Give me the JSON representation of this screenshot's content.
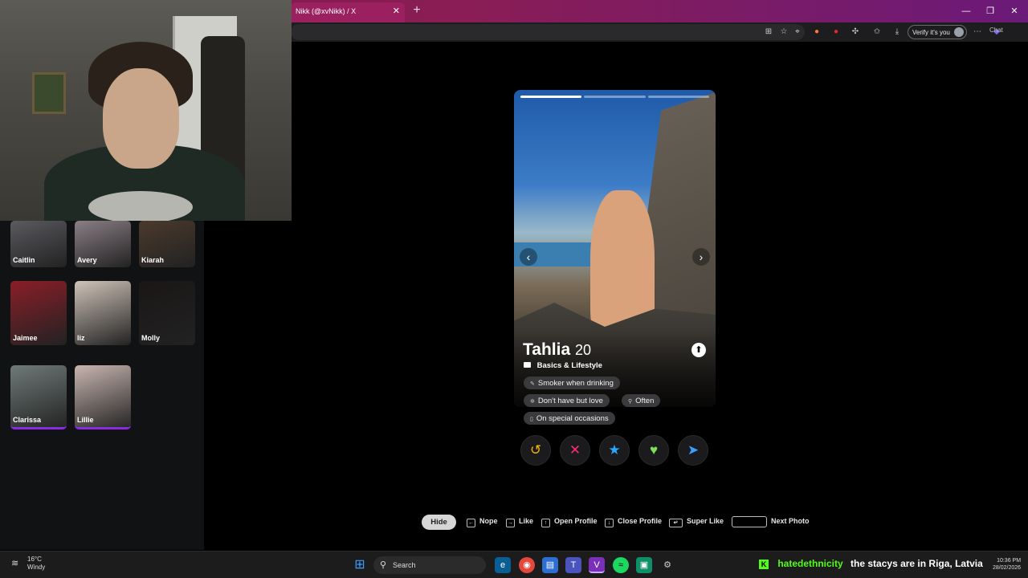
{
  "browser": {
    "tab_title": "Nikk (@xvNikk) / X",
    "tab_close": "✕",
    "new_tab": "+",
    "verify_label": "Verify it's you",
    "chat_label": "Chat",
    "window_controls": {
      "minimize": "—",
      "restore": "❐",
      "close": "✕"
    }
  },
  "matches": [
    {
      "name": "Caitlin",
      "color": "#5a5a60"
    },
    {
      "name": "Avery",
      "color": "#8a7f86"
    },
    {
      "name": "Kiarah",
      "color": "#4b3a2c"
    },
    {
      "name": "Jaimee",
      "color": "#8a1e28"
    },
    {
      "name": "liz",
      "color": "#cfc3b8"
    },
    {
      "name": "Molly",
      "color": "#1a1616"
    },
    {
      "name": "Clarissa",
      "color": "#6f7a78"
    },
    {
      "name": "Lillie",
      "color": "#c9b6b0"
    }
  ],
  "profile": {
    "name": "Tahlia",
    "age": "20",
    "section_title": "Basics & Lifestyle",
    "tags": [
      "Smoker when drinking",
      "Don't have but love",
      "Often",
      "On special occasions"
    ],
    "photo_index": 1,
    "photo_count": 3
  },
  "actions": {
    "rewind": "↺",
    "nope": "✕",
    "super_like": "★",
    "like": "♥",
    "boost": "➤"
  },
  "hints": {
    "hide": "Hide",
    "nope": "Nope",
    "like": "Like",
    "open_profile": "Open Profile",
    "close_profile": "Close Profile",
    "super_like": "Super Like",
    "next_photo": "Next Photo"
  },
  "taskbar": {
    "temperature": "16°C",
    "weather": "Windy",
    "search_placeholder": "Search",
    "ticker_user": "hatedethnicity",
    "ticker_message": "the stacys are in Riga, Latvia",
    "time": "10:36 PM",
    "date": "28/02/2026"
  },
  "colors": {
    "nope": "#ff2d6f",
    "super_like": "#2aa7ff",
    "like": "#7ee05a",
    "rewind": "#f5b400",
    "boost": "#3aa0ff",
    "match_highlight": "#8a2be2",
    "kick_green": "#53fc18"
  }
}
